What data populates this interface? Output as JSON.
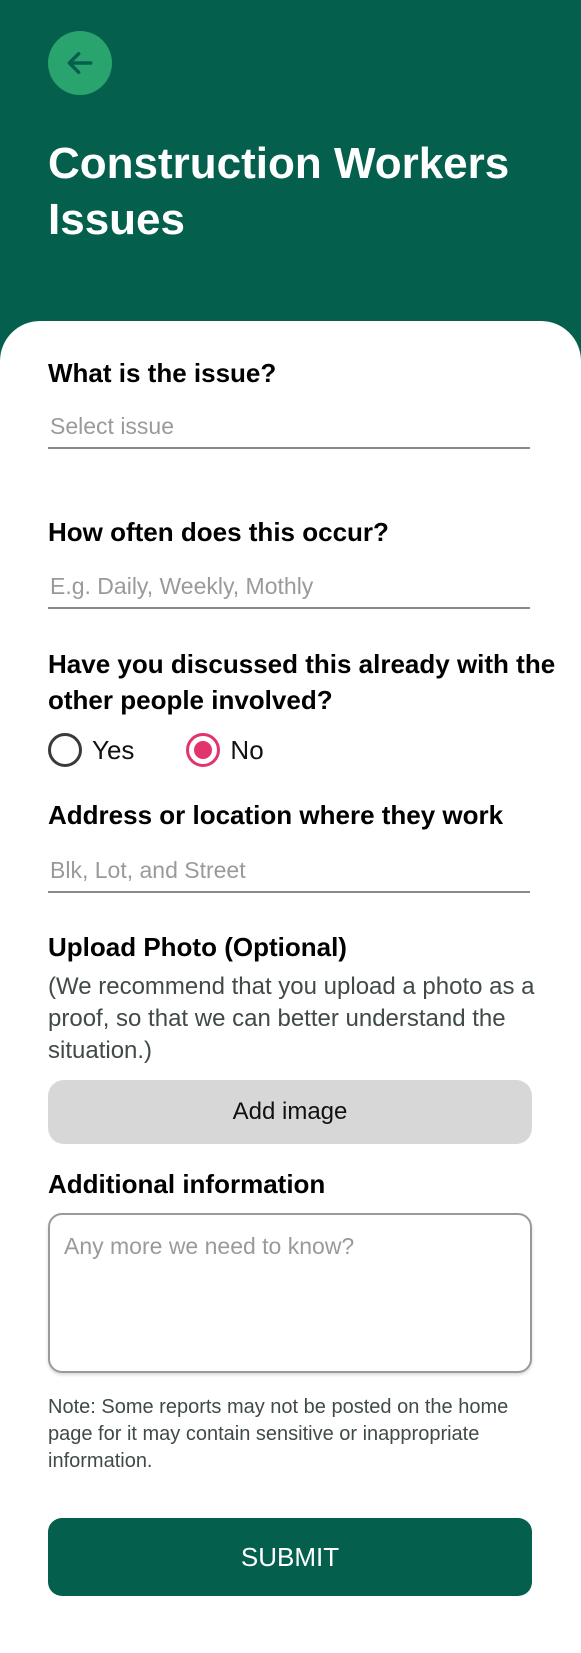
{
  "header": {
    "back_icon": "arrow-left-icon",
    "title": "Construction Workers Issues"
  },
  "form": {
    "issue": {
      "label": "What is the issue?",
      "placeholder": "Select issue",
      "value": ""
    },
    "frequency": {
      "label": "How often does this occur?",
      "placeholder": "E.g. Daily, Weekly, Mothly",
      "value": ""
    },
    "discussed": {
      "label": "Have you discussed this already with the other people involved?",
      "options": [
        {
          "label": "Yes",
          "checked": false
        },
        {
          "label": "No",
          "checked": true
        }
      ]
    },
    "address": {
      "label": "Address or location where they work",
      "placeholder": "Blk, Lot, and Street",
      "value": ""
    },
    "upload": {
      "label": "Upload Photo (Optional)",
      "description": "(We recommend that you upload a photo as a proof, so that we can better understand the situation.)",
      "button_label": "Add image"
    },
    "additional": {
      "label": "Additional information",
      "placeholder": "Any more we need to know?"
    },
    "note": "Note: Some reports may not be posted on the home page for it may contain sensitive or inappropriate information.",
    "submit_label": "SUBMIT"
  },
  "colors": {
    "primary": "#045f4d",
    "back_button": "#2aa46e",
    "radio_accent": "#e2346d",
    "upload_button": "#d7d7d7"
  }
}
